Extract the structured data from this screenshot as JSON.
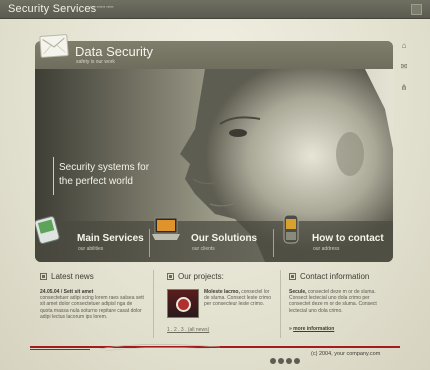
{
  "header": {
    "site_title": "Security Services",
    "sub_text": "▪▪▪▪ ▪▪▪▪▪▪ ▪▪▪▪▪"
  },
  "side_icons": [
    {
      "icon": "home-icon",
      "glyph": "⌂"
    },
    {
      "icon": "mail-icon",
      "glyph": "✉"
    },
    {
      "icon": "sitemap-icon",
      "glyph": "⋔"
    }
  ],
  "panel": {
    "title": "Data Security",
    "subtitle": "safety is our work",
    "tagline_line1": "Security systems for",
    "tagline_line2": "the perfect world"
  },
  "nav": [
    {
      "label": "Main Services",
      "sub": "our abilities",
      "icon": "pda-icon"
    },
    {
      "label": "Our Solutions",
      "sub": "our clients",
      "icon": "laptop-icon"
    },
    {
      "label": "How to contact",
      "sub": "our address",
      "icon": "phone-icon"
    }
  ],
  "latest_news": {
    "title": "Latest news",
    "date_line": "24.05.04 / Sett sit amet",
    "body": "consectetuer adipi scing lorem raes salsea sett sit amet dolor consectetuer adipisl nga de quota massa nula soturno repitare casat dolor adipi lectus lacorum ips lorem."
  },
  "projects": {
    "title": "Our projects:",
    "lead": "Moleste lacmo,",
    "body": "consectel lor de sluma. Consect leste crimo per consecteur leste crimo."
  },
  "contact": {
    "title": "Contact information",
    "lead": "Secule,",
    "body": "consectel deze m or de sluma. Consect lectecial uno dola crimo per consectet deze m or de sluma. Consect lectecial uno dola crimo.",
    "more_link": "more information"
  },
  "pager": "1 . 2 . 3 . (all news)",
  "footer": {
    "copyright": "(c) 2004, your company.com"
  },
  "colors": {
    "accent_red": "#a31b1b",
    "panel_header": "#7f7d6b",
    "page_bg": "#e4e2d1"
  }
}
